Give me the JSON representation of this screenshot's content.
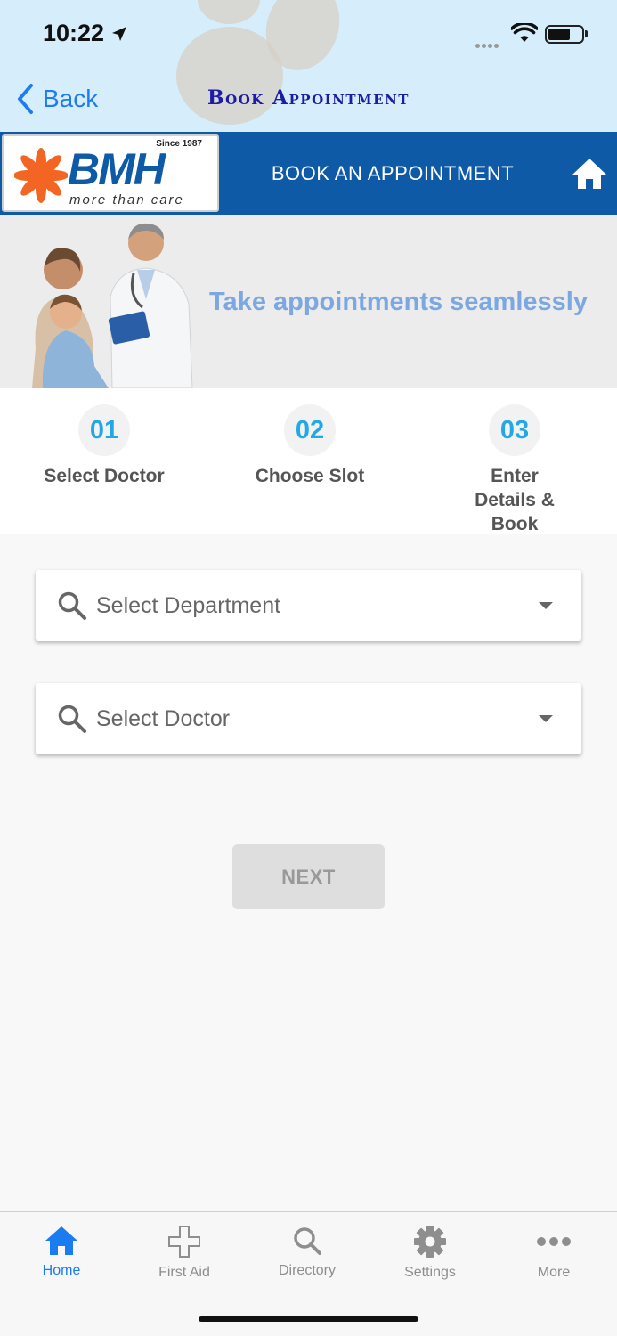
{
  "status_bar": {
    "time": "10:22"
  },
  "nav": {
    "back_label": "Back",
    "title": "Book Appointment"
  },
  "banner": {
    "logo_mark": "BMH",
    "logo_since": "Since 1987",
    "logo_tagline": "more than care",
    "title": "BOOK AN APPOINTMENT",
    "home_icon": "home-icon"
  },
  "hero": {
    "tagline": "Take appointments seamlessly"
  },
  "steps": [
    {
      "number": "01",
      "label": "Select Doctor"
    },
    {
      "number": "02",
      "label": "Choose Slot"
    },
    {
      "number": "03",
      "label": "Enter Details & Book"
    }
  ],
  "form": {
    "department_placeholder": "Select Department",
    "doctor_placeholder": "Select Doctor",
    "next_label": "NEXT"
  },
  "tabbar": {
    "items": [
      {
        "label": "Home",
        "icon": "home-icon",
        "active": true
      },
      {
        "label": "First Aid",
        "icon": "plus-icon",
        "active": false
      },
      {
        "label": "Directory",
        "icon": "search-icon",
        "active": false
      },
      {
        "label": "Settings",
        "icon": "gear-icon",
        "active": false
      },
      {
        "label": "More",
        "icon": "more-icon",
        "active": false
      }
    ]
  },
  "colors": {
    "brand_blue": "#0e5aa7",
    "nav_title": "#1c1ca8",
    "step_accent": "#22a8e6",
    "tab_active": "#1b7cf2",
    "tagline": "#7ca7e0"
  }
}
